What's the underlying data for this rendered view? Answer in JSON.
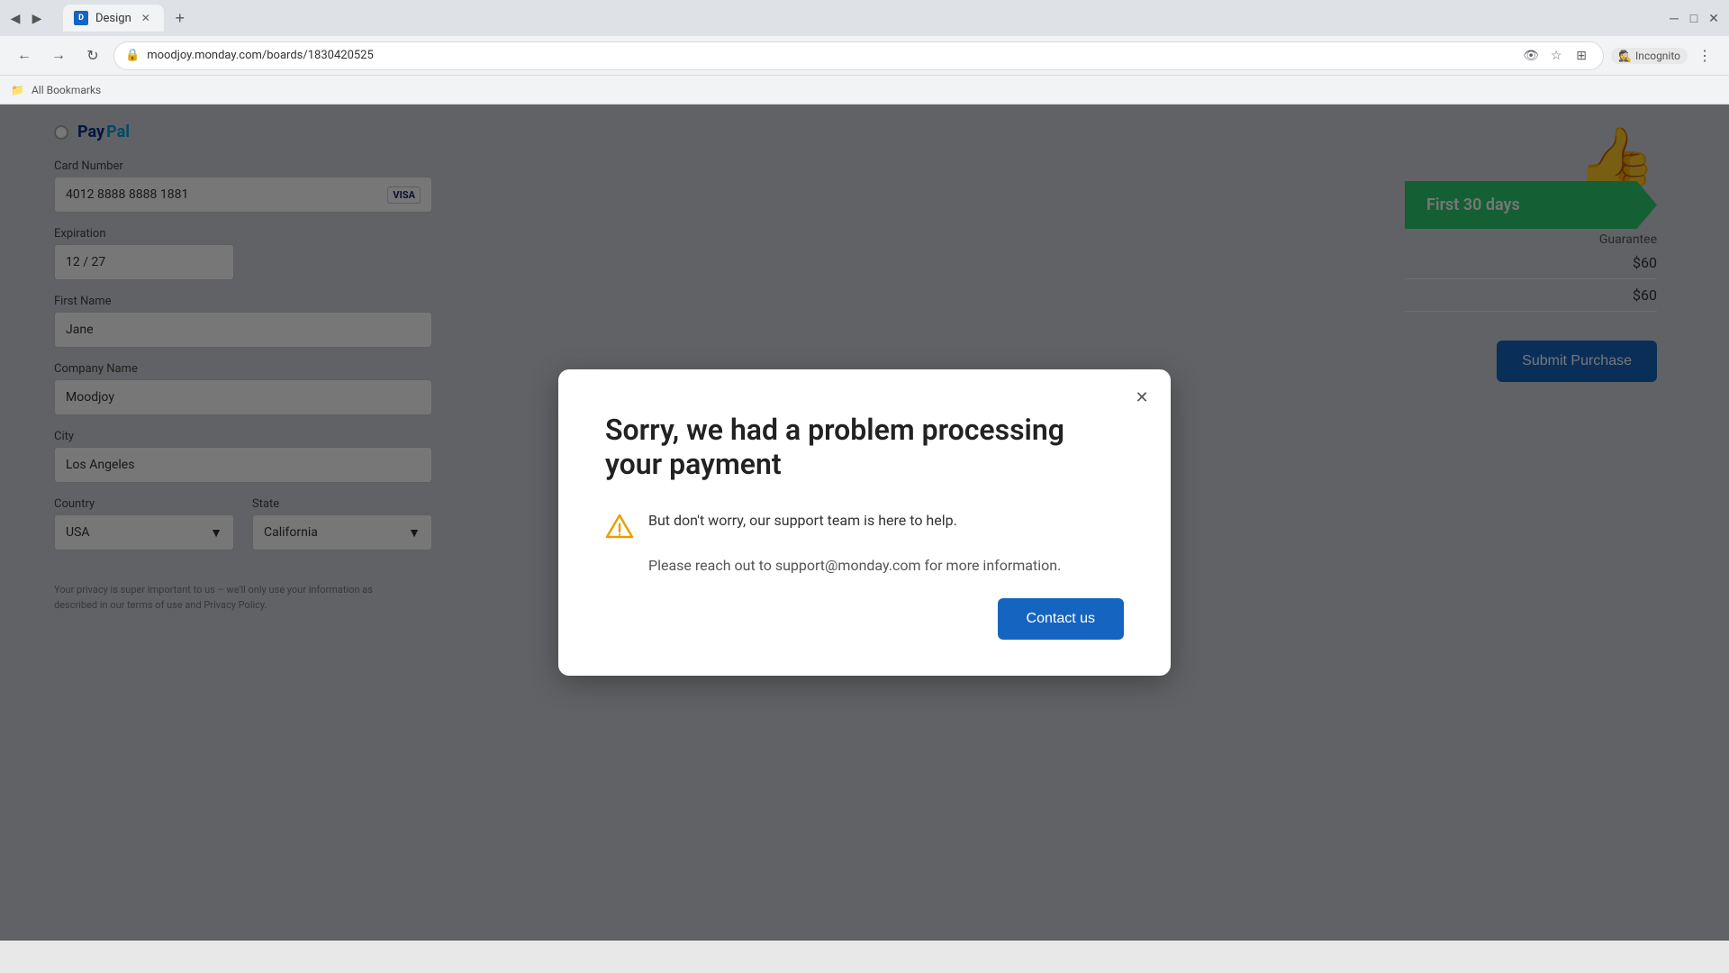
{
  "browser": {
    "tab_label": "Design",
    "url": "moodjoy.monday.com/boards/1830420525",
    "incognito_label": "Incognito",
    "bookmarks_label": "All Bookmarks",
    "new_tab_tooltip": "New tab"
  },
  "background_page": {
    "paypal_label": "PayPal",
    "card_number_label": "Card Number",
    "card_number_value": "4012 8888 8888 1881",
    "card_badge": "VISA",
    "expiration_label": "Expiration",
    "expiration_value": "12 / 27",
    "first_name_label": "First Name",
    "first_name_value": "Jane",
    "company_name_label": "Company Name",
    "company_name_value": "Moodjoy",
    "city_label": "City",
    "city_value": "Los Angeles",
    "country_label": "Country",
    "country_value": "USA",
    "state_label": "State",
    "state_value": "California",
    "guarantee_label": "First 30 days",
    "guarantee_sub": "Guarantee",
    "price1": "$60",
    "price2": "$60",
    "submit_label": "Submit Purchase",
    "privacy_text": "Your privacy is super important to us – we'll only use your information as described in our terms of use and Privacy Policy."
  },
  "modal": {
    "title": "Sorry, we had a problem processing your payment",
    "support_text": "But don't worry, our support team is here to help.",
    "contact_info": "Please reach out to support@monday.com for more information.",
    "contact_button_label": "Contact us",
    "close_button_label": "✕"
  },
  "icons": {
    "warning_color": "#e8a000",
    "button_color": "#1565c0"
  }
}
